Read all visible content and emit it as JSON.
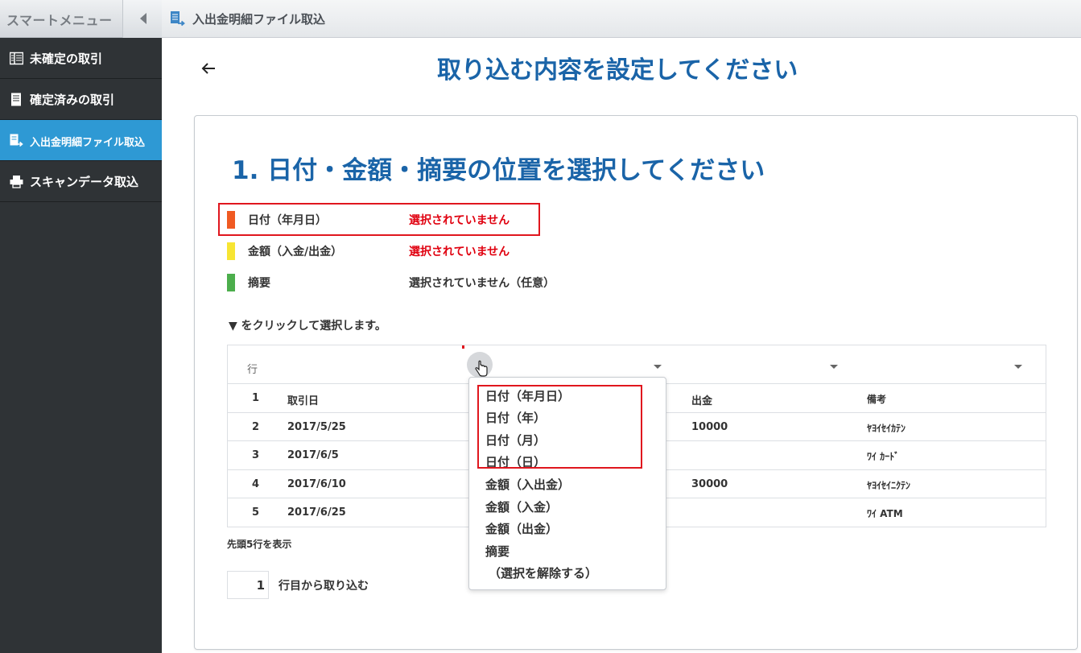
{
  "sidebar": {
    "title": "スマートメニュー",
    "items": [
      {
        "label": "未確定の取引",
        "icon": "columns-icon",
        "active": false
      },
      {
        "label": "確定済みの取引",
        "icon": "document-icon",
        "active": false
      },
      {
        "label": "入出金明細ファイル取込",
        "icon": "file-import-icon",
        "active": true
      },
      {
        "label": "スキャンデータ取込",
        "icon": "scanner-icon",
        "active": false
      }
    ]
  },
  "header": {
    "title": "入出金明細ファイル取込",
    "icon": "file-import-icon"
  },
  "main": {
    "page_title": "取り込む内容を設定してください",
    "section_title": "1. 日付・金額・摘要の位置を選択してください",
    "legend": [
      {
        "label": "日付（年月日）",
        "status": "選択されていません",
        "color": "#f05a22"
      },
      {
        "label": "金額（入金/出金）",
        "status": "選択されていません",
        "color": "#f7e533"
      },
      {
        "label": "摘要",
        "status": "選択されていません（任意）",
        "color": "#4cae4c"
      }
    ],
    "instruction": "▼ をクリックして選択します。",
    "grid": {
      "header_label": "行",
      "rows": [
        {
          "num": "1",
          "date": "取引日",
          "out": "出金",
          "note": "備考"
        },
        {
          "num": "2",
          "date": "2017/5/25",
          "out": "10000",
          "note": "ﾔﾖｲｾｲｶﾃﾝ"
        },
        {
          "num": "3",
          "date": "2017/6/5",
          "out": "",
          "note": "ﾜｲ ｶｰﾄﾞ"
        },
        {
          "num": "4",
          "date": "2017/6/10",
          "out": "30000",
          "note": "ﾔﾖｲｾｲﾆｸﾃﾝ"
        },
        {
          "num": "5",
          "date": "2017/6/25",
          "out": "",
          "note": "ﾜｲ ATM"
        }
      ]
    },
    "preview_note": "先頭5行を表示",
    "start_row": {
      "value": "1",
      "label": "行目から取り込む"
    },
    "dropdown": {
      "options": [
        "日付（年月日）",
        "日付（年）",
        "日付（月）",
        "日付（日）",
        "金額（入出金）",
        "金額（入金）",
        "金額（出金）",
        "摘要",
        "（選択を解除する）"
      ]
    }
  },
  "colors": {
    "accent_blue": "#1a64a8",
    "sidebar_bg": "#2f3336",
    "active_item": "#2e99d4",
    "error_red": "#e0000f"
  }
}
